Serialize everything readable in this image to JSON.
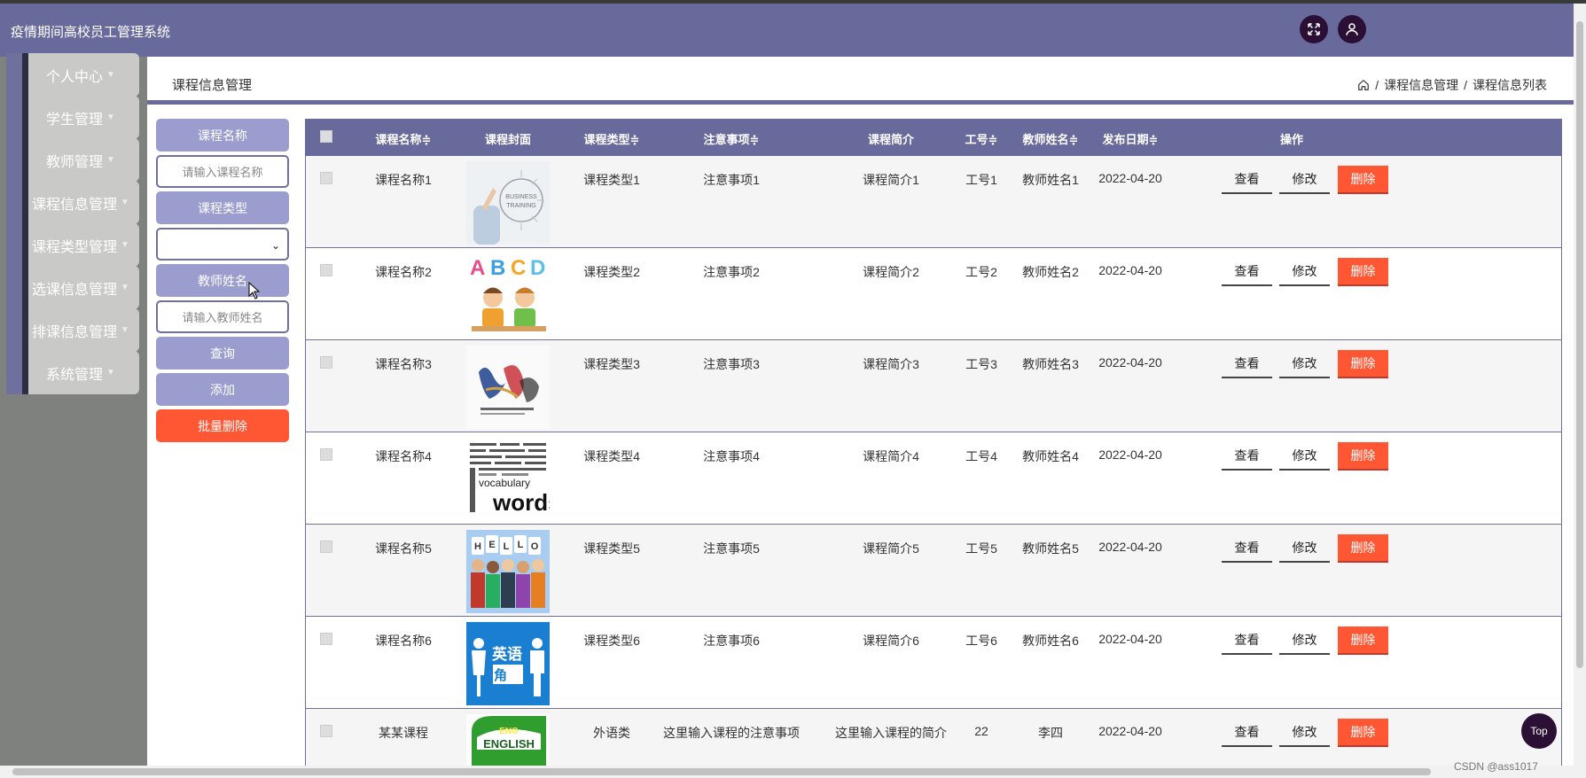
{
  "app": {
    "title": "疫情期间高校员工管理系统"
  },
  "header": {
    "fullscreen_icon": "expand-icon",
    "user_icon": "user-icon"
  },
  "sidebar": {
    "items": [
      {
        "label": "个人中心"
      },
      {
        "label": "学生管理"
      },
      {
        "label": "教师管理"
      },
      {
        "label": "课程信息管理"
      },
      {
        "label": "课程类型管理"
      },
      {
        "label": "选课信息管理"
      },
      {
        "label": "排课信息管理"
      },
      {
        "label": "系统管理"
      }
    ]
  },
  "page": {
    "title": "课程信息管理",
    "breadcrumb": [
      "课程信息管理",
      "课程信息列表"
    ]
  },
  "search": {
    "course_name_label": "课程名称",
    "course_name_placeholder": "请输入课程名称",
    "course_type_label": "课程类型",
    "course_type_value": "",
    "teacher_name_label": "教师姓名",
    "teacher_name_placeholder": "请输入教师姓名",
    "query_label": "查询",
    "add_label": "添加",
    "batch_delete_label": "批量删除"
  },
  "table": {
    "columns": [
      "课程名称",
      "课程封面",
      "课程类型",
      "注意事项",
      "课程简介",
      "工号",
      "教师姓名",
      "发布日期",
      "操作"
    ],
    "sortable_mark": "≑",
    "actions": {
      "view": "查看",
      "edit": "修改",
      "delete": "删除"
    },
    "rows": [
      {
        "name": "课程名称1",
        "cover": "business-training-image",
        "type": "课程类型1",
        "notes": "注意事项1",
        "intro": "课程简介1",
        "id": "工号1",
        "teacher": "教师姓名1",
        "date": "2022-04-20"
      },
      {
        "name": "课程名称2",
        "cover": "abcd-kids-image",
        "type": "课程类型2",
        "notes": "注意事项2",
        "intro": "课程简介2",
        "id": "工号2",
        "teacher": "教师姓名2",
        "date": "2022-04-20"
      },
      {
        "name": "课程名称3",
        "cover": "calligraphy-image",
        "type": "课程类型3",
        "notes": "注意事项3",
        "intro": "课程简介3",
        "id": "工号3",
        "teacher": "教师姓名3",
        "date": "2022-04-20"
      },
      {
        "name": "课程名称4",
        "cover": "vocabulary-words-image",
        "type": "课程类型4",
        "notes": "注意事项4",
        "intro": "课程简介4",
        "id": "工号4",
        "teacher": "教师姓名4",
        "date": "2022-04-20"
      },
      {
        "name": "课程名称5",
        "cover": "hello-people-image",
        "type": "课程类型5",
        "notes": "注意事项5",
        "intro": "课程简介5",
        "id": "工号5",
        "teacher": "教师姓名5",
        "date": "2022-04-20"
      },
      {
        "name": "课程名称6",
        "cover": "english-corner-image",
        "type": "课程类型6",
        "notes": "注意事项6",
        "intro": "课程简介6",
        "id": "工号6",
        "teacher": "教师姓名6",
        "date": "2022-04-20"
      },
      {
        "name": "某某课程",
        "cover": "english-leaf-image",
        "type": "外语类",
        "notes": "这里输入课程的注意事项",
        "intro": "这里输入课程的简介",
        "id": "22",
        "teacher": "李四",
        "date": "2022-04-20"
      }
    ]
  },
  "top_button": "Top",
  "watermark": "CSDN @ass1017",
  "colors": {
    "primary": "#686a9c",
    "light": "#9b9dce",
    "danger": "#ff5733",
    "dark": "#2b0f35"
  }
}
